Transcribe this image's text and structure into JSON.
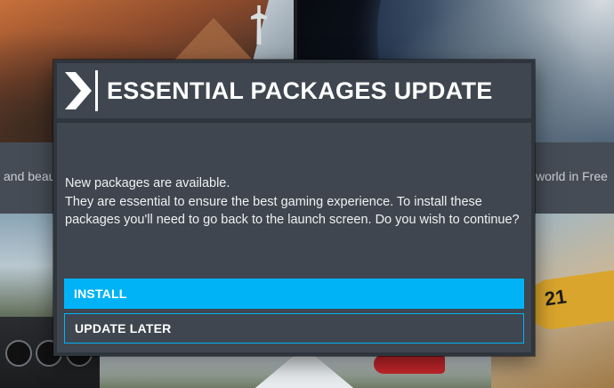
{
  "background": {
    "left_caption": "and beau",
    "right_caption": "world in Free",
    "plane_number": "21"
  },
  "dialog": {
    "title": "ESSENTIAL PACKAGES UPDATE",
    "icon": "chevron-right-icon",
    "message_lines": [
      "New packages are available.",
      "They are essential to ensure the best gaming experience. To install these",
      "packages you'll need to go back to the launch screen. Do you wish to continue?"
    ],
    "buttons": {
      "install": "INSTALL",
      "update_later": "UPDATE LATER"
    }
  },
  "colors": {
    "accent": "#00b3f7",
    "panel": "#3f464f",
    "frame": "#2f353c",
    "text": "#ffffff"
  }
}
